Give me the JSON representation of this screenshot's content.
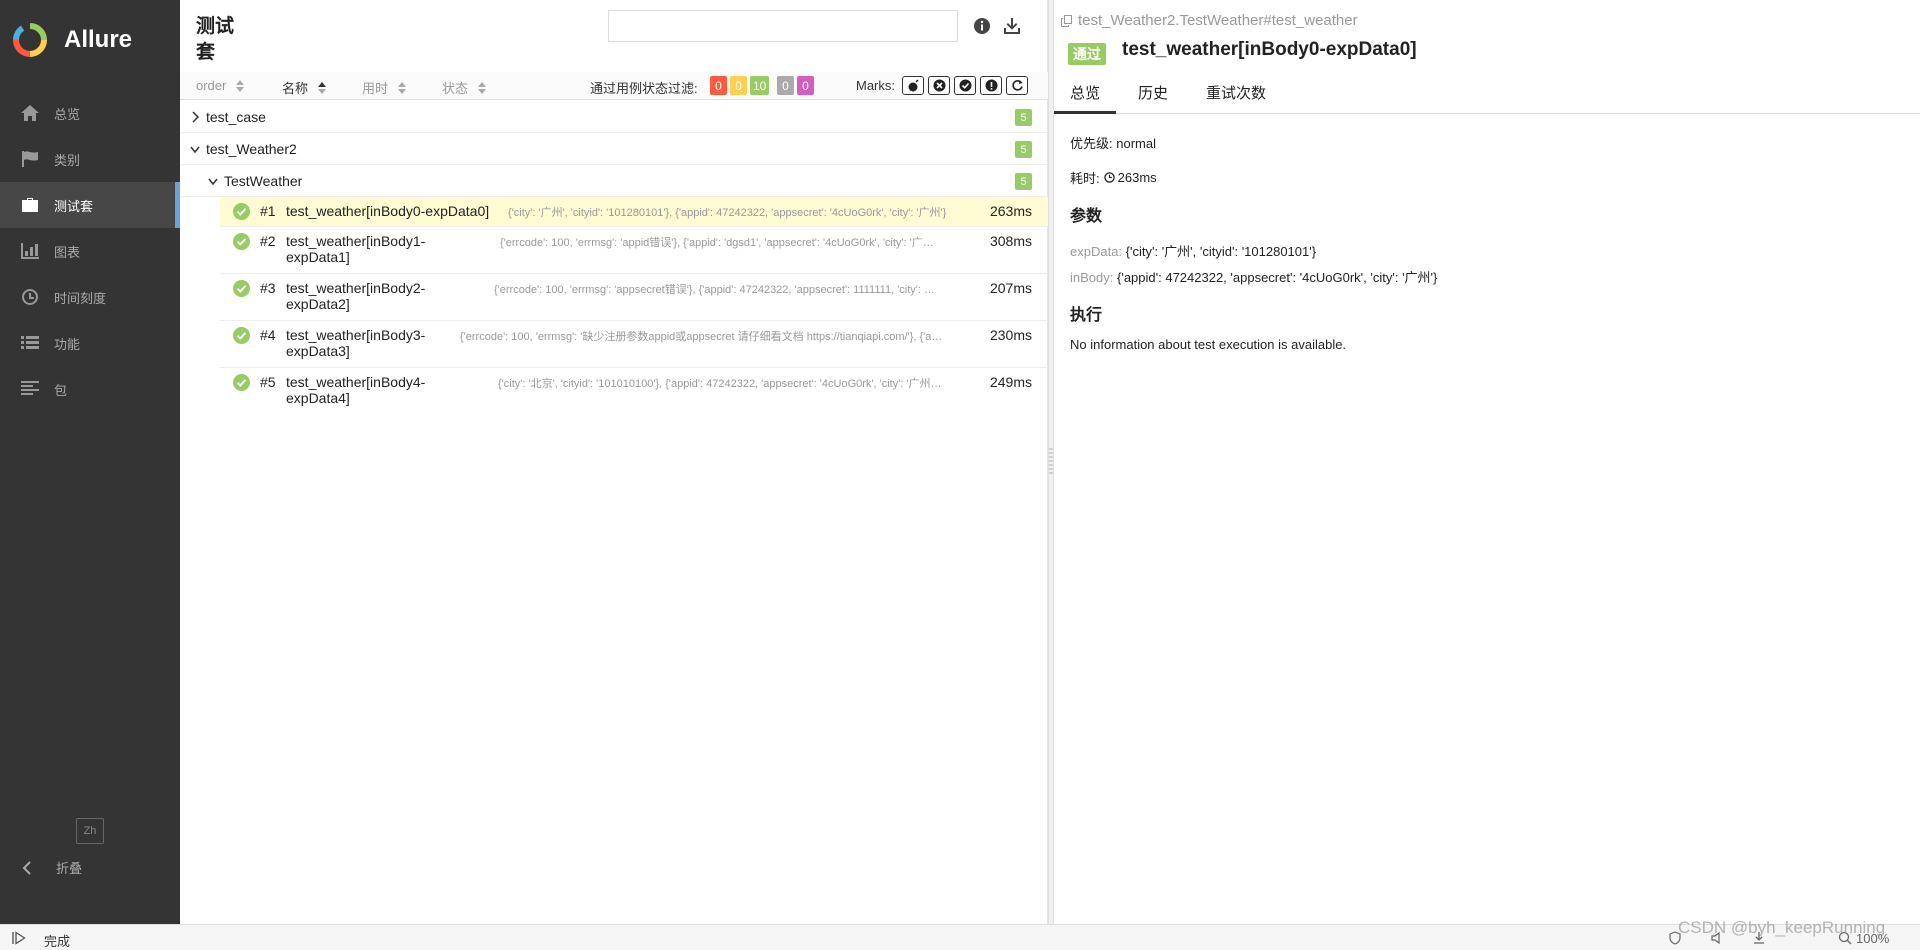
{
  "brand": {
    "name": "Allure"
  },
  "sidebar": {
    "items": [
      {
        "label": "总览",
        "icon": "home-icon"
      },
      {
        "label": "类别",
        "icon": "flag-icon"
      },
      {
        "label": "测试套",
        "icon": "briefcase-icon",
        "active": true
      },
      {
        "label": "图表",
        "icon": "bar-chart-icon"
      },
      {
        "label": "时间刻度",
        "icon": "clock-icon"
      },
      {
        "label": "功能",
        "icon": "list-icon"
      },
      {
        "label": "包",
        "icon": "align-left-icon"
      }
    ],
    "lang": "Zh",
    "collapse_label": "折叠"
  },
  "middle": {
    "title": "测试套",
    "search": {
      "placeholder": ""
    },
    "sort": [
      {
        "label": "order"
      },
      {
        "label": "名称",
        "active": true
      },
      {
        "label": "用时"
      },
      {
        "label": "状态"
      }
    ],
    "filter_label": "通过用例状态过滤:",
    "status_counts": [
      {
        "value": "0",
        "color": "#fd5a3e"
      },
      {
        "value": "0",
        "color": "#ffd050"
      },
      {
        "value": "10",
        "color": "#97cc64"
      },
      {
        "value": "0",
        "color": "#aaaaaa"
      },
      {
        "value": "0",
        "color": "#d35ebe"
      }
    ],
    "marks_label": "Marks:",
    "groups": [
      {
        "name": "test_case",
        "count": "5",
        "expanded": false
      },
      {
        "name": "test_Weather2",
        "count": "5",
        "expanded": true
      },
      {
        "name": "TestWeather",
        "count": "5",
        "expanded": true
      }
    ],
    "tests": [
      {
        "num": "#1",
        "name": "test_weather[inBody0-expData0]",
        "params": "{'city': '广州', 'cityid': '101280101'}, {'appid': 47242322, 'appsecret': '4cUoG0rk', 'city': '广州'}",
        "duration": "263ms",
        "selected": true
      },
      {
        "num": "#2",
        "name": "test_weather[inBody1-expData1]",
        "params": "{'errcode': 100, 'errmsg': 'appid错误'}, {'appid': 'dgsd1', 'appsecret': '4cUoG0rk', 'city': '广…",
        "duration": "308ms"
      },
      {
        "num": "#3",
        "name": "test_weather[inBody2-expData2]",
        "params": "{'errcode': 100, 'errmsg': 'appsecret错误'}, {'appid': 47242322, 'appsecret': 1111111, 'city': …",
        "duration": "207ms"
      },
      {
        "num": "#4",
        "name": "test_weather[inBody3-expData3]",
        "params": "{'errcode': 100, 'errmsg': '缺少注册参数appid或appsecret 请仔细看文档 https://tianqiapi.com/'}, {'a…",
        "duration": "230ms"
      },
      {
        "num": "#5",
        "name": "test_weather[inBody4-expData4]",
        "params": "{'city': '北京', 'cityid': '101010100'}, {'appid': 47242322, 'appsecret': '4cUoG0rk', 'city': '广州…",
        "duration": "249ms"
      }
    ]
  },
  "right": {
    "breadcrumb": "test_Weather2.TestWeather#test_weather",
    "status_badge": "通过",
    "title": "test_weather[inBody0-expData0]",
    "tabs": [
      "总览",
      "历史",
      "重试次数"
    ],
    "priority_label": "优先级:",
    "priority_value": "normal",
    "duration_label": "耗时:",
    "duration_value": "263ms",
    "params_heading": "参数",
    "params": [
      {
        "key": "expData:",
        "value": "{'city': '广州', 'cityid': '101280101'}"
      },
      {
        "key": "inBody:",
        "value": "{'appid': 47242322, 'appsecret': '4cUoG0rk', 'city': '广州'}"
      }
    ],
    "execution_heading": "执行",
    "execution_text": "No information about test execution is available."
  },
  "statusbar": {
    "text": "完成",
    "zoom": "100%",
    "watermark": "CSDN @byh_keepRunning"
  }
}
